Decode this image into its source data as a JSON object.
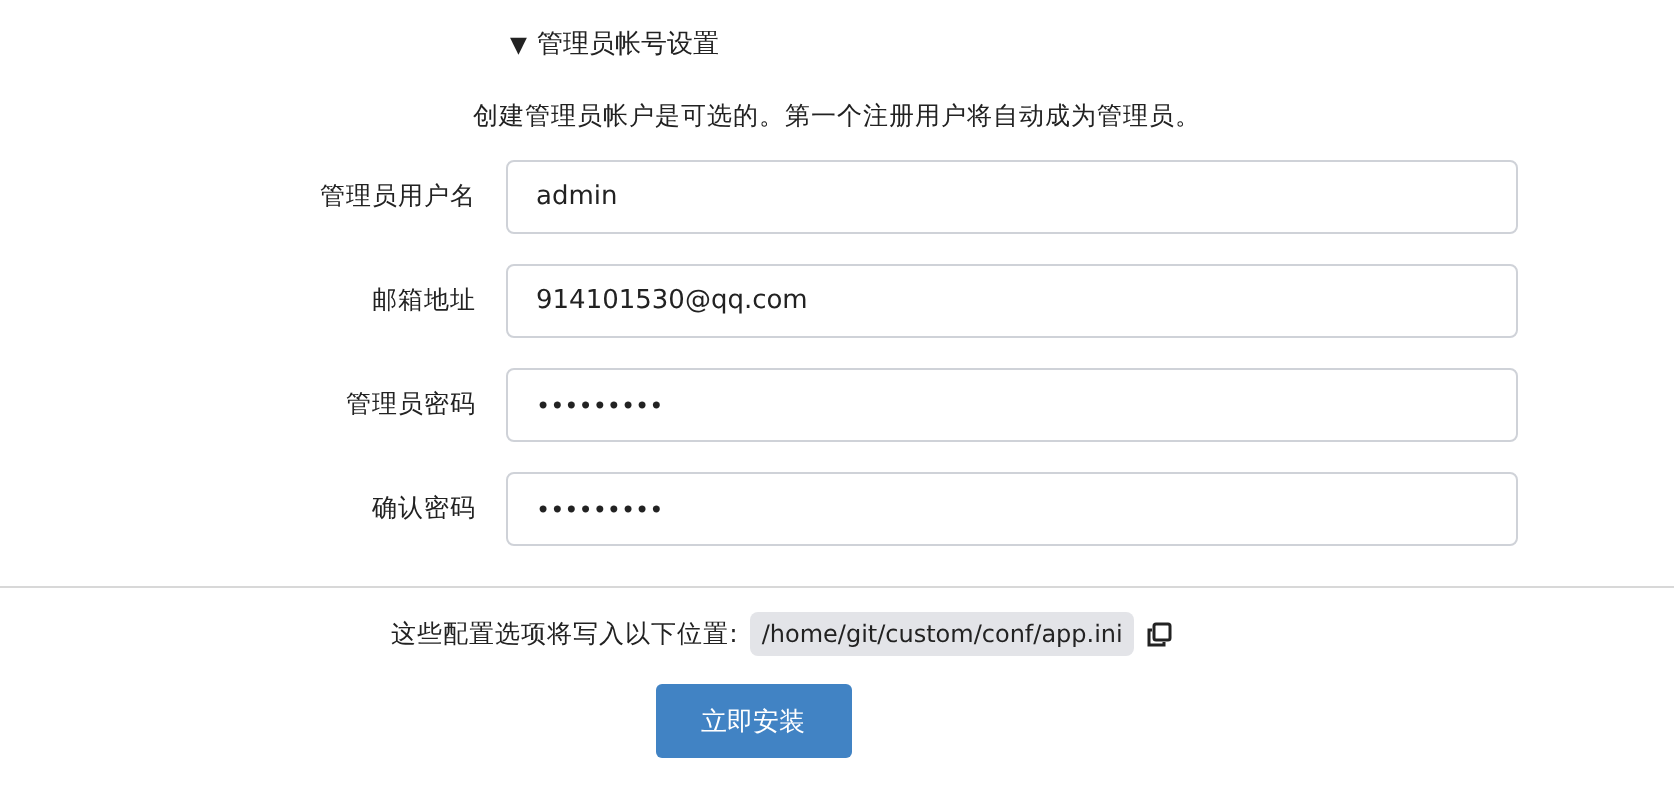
{
  "section": {
    "marker": "▼",
    "title": "管理员帐号设置",
    "expanded": true
  },
  "notice": "创建管理员帐户是可选的。第一个注册用户将自动成为管理员。",
  "fields": [
    {
      "label": "管理员用户名",
      "value": "admin",
      "kind": "text"
    },
    {
      "label": "邮箱地址",
      "value": "914101530@qq.com",
      "kind": "text"
    },
    {
      "label": "管理员密码",
      "value": "•••••••••",
      "kind": "password"
    },
    {
      "label": "确认密码",
      "value": "•••••••••",
      "kind": "password"
    }
  ],
  "config_note": {
    "label": "这些配置选项将写入以下位置:",
    "path": "/home/git/custom/conf/app.ini"
  },
  "buttons": [
    "立即安装"
  ]
}
